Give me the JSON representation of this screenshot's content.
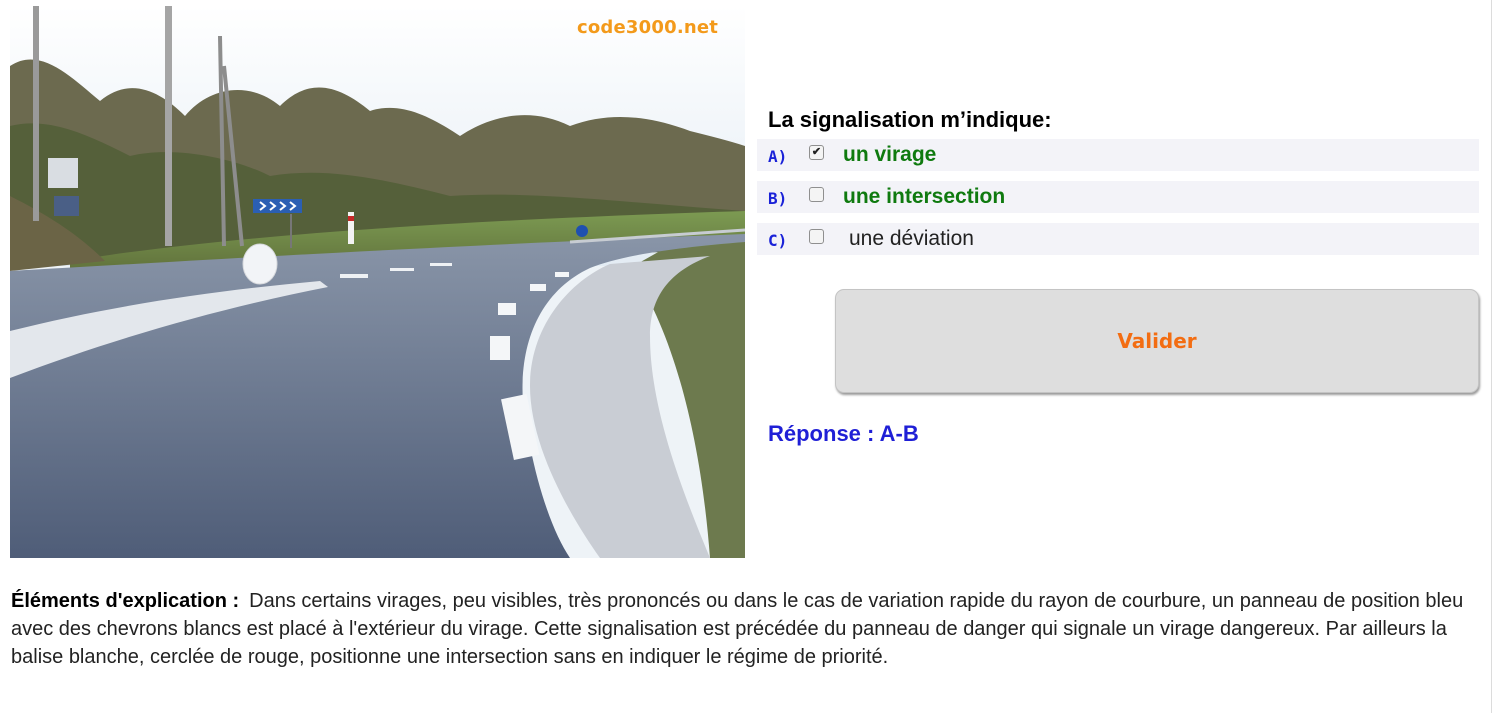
{
  "image": {
    "watermark": "code3000.net"
  },
  "quiz": {
    "question": "La signalisation m’indique:",
    "choices": [
      {
        "letter": "A)",
        "text": "un virage",
        "checked": true,
        "style": "ok"
      },
      {
        "letter": "B)",
        "text": "une intersection",
        "checked": false,
        "style": "ok"
      },
      {
        "letter": "C)",
        "text": "une déviation",
        "checked": false,
        "style": "plain"
      }
    ],
    "validate_label": "Valider",
    "answer": "Réponse : A-B"
  },
  "explanation": {
    "label": "Éléments d'explication :",
    "text": "Dans certains virages, peu visibles, très prononcés ou dans le cas de variation rapide du rayon de courbure, un panneau de position bleu avec des chevrons blancs est placé à l'extérieur du virage. Cette signalisation est précédée du panneau de danger qui signale un virage dangereux. Par ailleurs la balise blanche, cerclée de rouge, positionne une intersection sans en indiquer le régime de priorité."
  },
  "colors": {
    "correct_choice": "#0f7a0f",
    "letter": "#1a22d8",
    "validate_text": "#f36d12",
    "answer": "#1f1fd6",
    "watermark": "#f39a1b"
  }
}
